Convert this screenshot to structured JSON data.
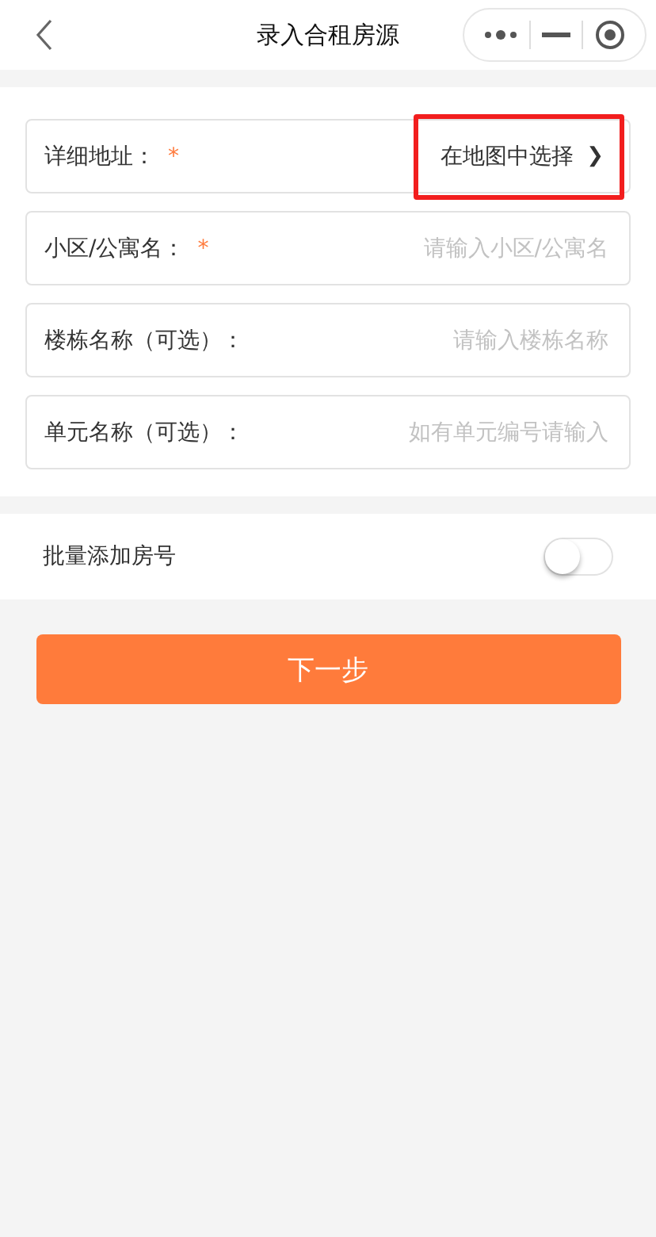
{
  "nav_bar": {
    "title": "录入合租房源"
  },
  "fields": [
    {
      "kind": "picker",
      "label": "详细地址：",
      "required_mark": "*",
      "action": "在地图中选择",
      "action_icon": "❯",
      "highlighted": true
    },
    {
      "kind": "input",
      "label": "小区/公寓名：",
      "required_mark": "*",
      "placeholder": "请输入小区/公寓名"
    },
    {
      "kind": "input",
      "label": "楼栋名称（可选）：",
      "placeholder": "请输入楼栋名称"
    },
    {
      "kind": "input",
      "label": "单元名称（可选）：",
      "placeholder": "如有单元编号请输入"
    }
  ],
  "batch_toggle": {
    "label": "批量添加房号",
    "on": false
  },
  "next_button": "下一步"
}
